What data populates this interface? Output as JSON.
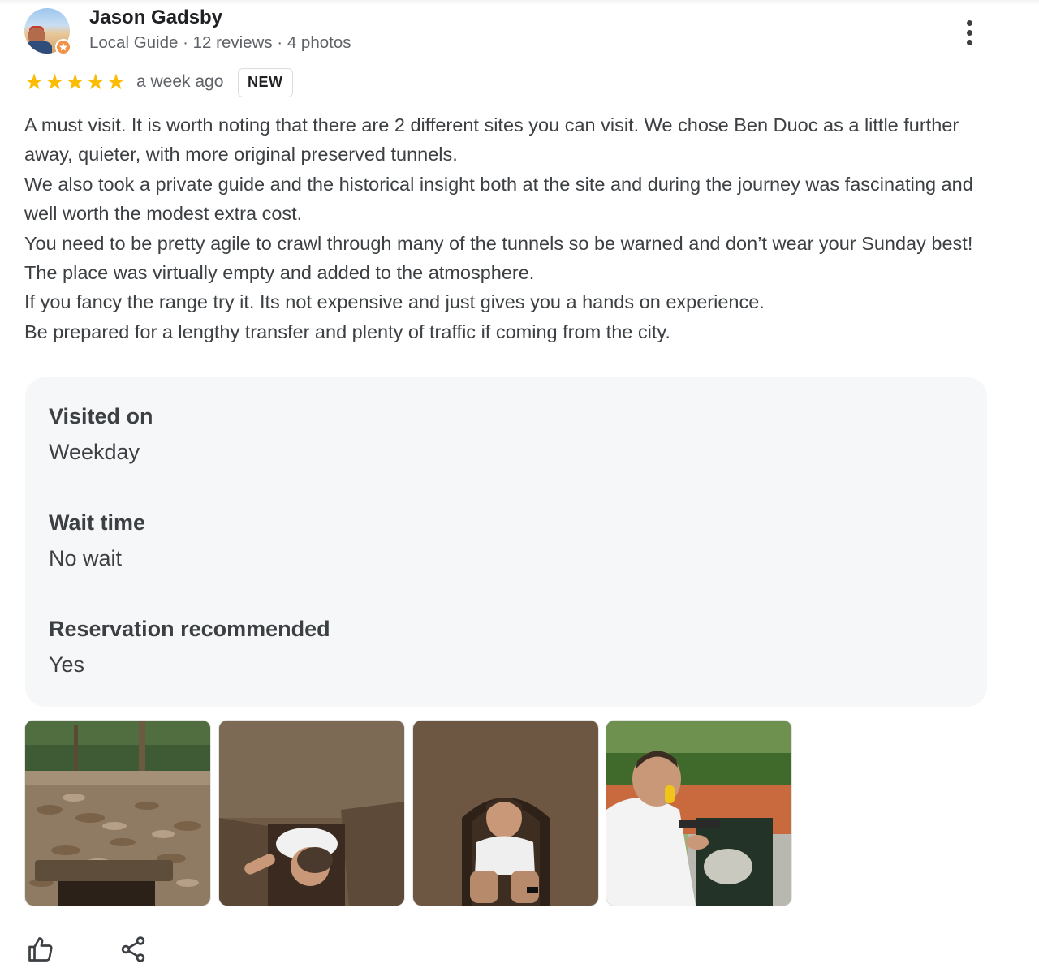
{
  "author": {
    "name": "Jason Gadsby",
    "meta": "Local Guide · 12 reviews · 4 photos",
    "avatar_icon": "user-avatar",
    "badge_icon": "local-guide-star-icon"
  },
  "rating": {
    "stars": 5,
    "max_stars": 5,
    "star_glyph": "★",
    "time_ago": "a week ago",
    "badge": "NEW"
  },
  "review": {
    "paragraphs": [
      "A must visit. It is worth noting that there are 2 different sites you can visit. We chose Ben Duoc as a little further away, quieter, with more original preserved tunnels.",
      "We also took a private guide and the historical insight both at the site and during the journey was fascinating and well worth the modest extra cost.",
      "You need to be pretty agile to crawl through many of the tunnels so be warned and don’t wear your Sunday best!",
      "The place was virtually empty and added to the atmosphere.",
      "If you fancy the range try it. Its not expensive and just gives you a hands on experience.",
      "Be prepared for a lengthy transfer and plenty of traffic if coming from the city."
    ]
  },
  "details": [
    {
      "label": "Visited on",
      "value": "Weekday"
    },
    {
      "label": "Wait time",
      "value": "No wait"
    },
    {
      "label": "Reservation recommended",
      "value": "Yes"
    }
  ],
  "photos": [
    {
      "name": "photo-tunnel-entrance-leaves"
    },
    {
      "name": "photo-man-in-tunnel-hatch"
    },
    {
      "name": "photo-man-crouching-in-tunnel"
    },
    {
      "name": "photo-man-at-shooting-range"
    }
  ],
  "actions": {
    "like_icon": "thumbs-up-icon",
    "share_icon": "share-icon"
  },
  "colors": {
    "star": "#fbbc04",
    "badge_orange": "#f29248",
    "card_bg": "#f6f7f9",
    "text_primary": "#202124",
    "text_secondary": "#5f6368"
  }
}
